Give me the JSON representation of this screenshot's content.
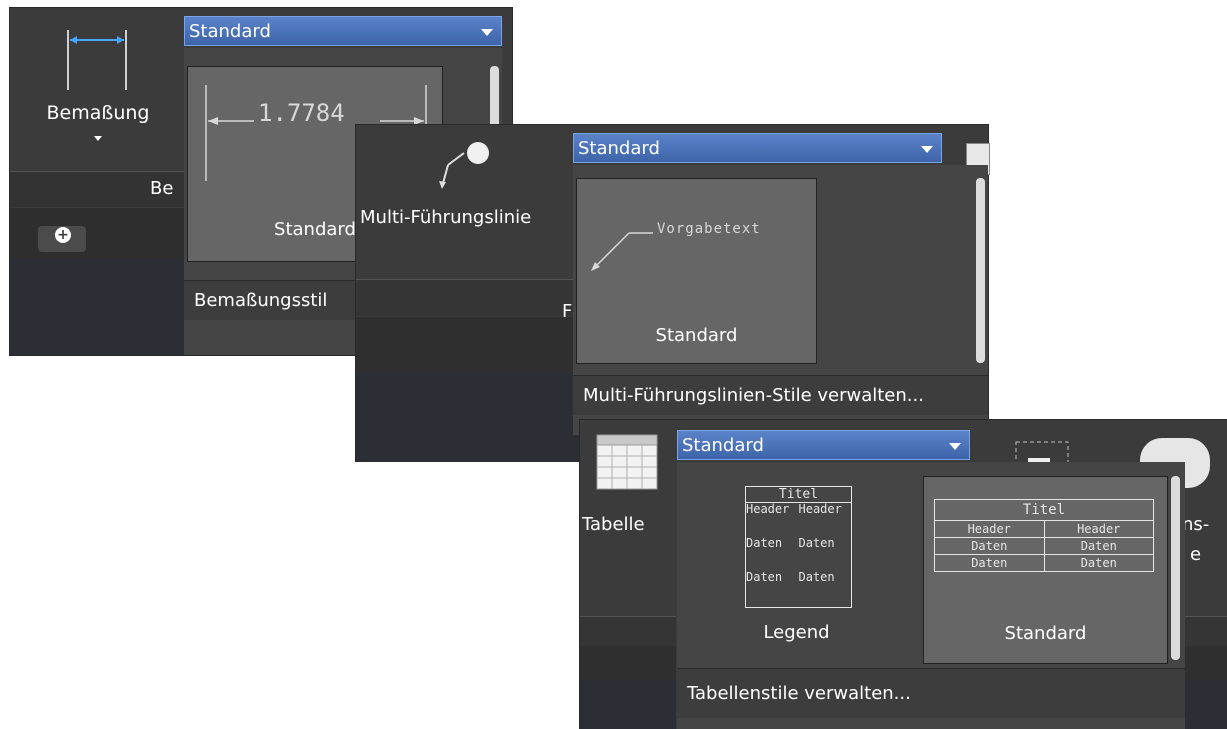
{
  "panel1": {
    "tool_label": "Bemaßung",
    "panel_title": "Be",
    "add_tab": "+",
    "dropdown_value": "Standard",
    "preview_value": "1.7784",
    "tile_label": "Standard",
    "manage_label": "Bemaßungsstil"
  },
  "panel2": {
    "tool_label": "Multi-Führungslinie",
    "panel_title": "F",
    "dropdown_value": "Standard",
    "preview_text": "Vorgabetext",
    "tile_label": "Standard",
    "manage_label": "Multi-Führungslinien-Stile verwalten..."
  },
  "panel3": {
    "tool_label": "Tabelle",
    "right_label_1": "ns-",
    "right_label_2": "e",
    "dropdown_value": "Standard",
    "tile1": {
      "label": "Legend",
      "title": "Titel",
      "headers": [
        "Header",
        "Header"
      ],
      "row1": [
        "Daten",
        "Daten"
      ],
      "row2": [
        "Daten",
        "Daten"
      ]
    },
    "tile2": {
      "label": "Standard",
      "title": "Titel",
      "headers": [
        "Header",
        "Header"
      ],
      "row1": [
        "Daten",
        "Daten"
      ],
      "row2": [
        "Daten",
        "Daten"
      ]
    },
    "manage_label": "Tabellenstile verwalten..."
  },
  "colors": {
    "panel_bg": "#3b3b3b",
    "dropdown_blue": "#4a72b8",
    "tile_bg": "#5a5a5a"
  }
}
